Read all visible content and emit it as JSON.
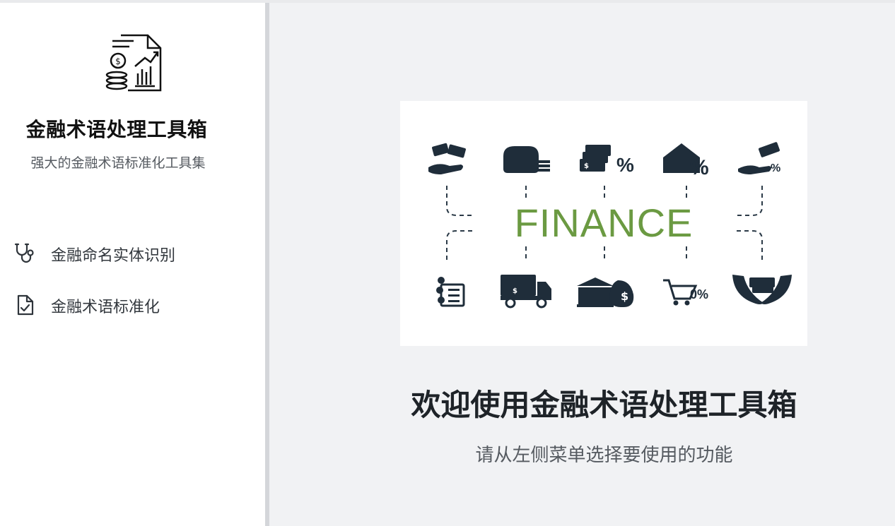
{
  "sidebar": {
    "logo_icon": "finance-report-icon",
    "title": "金融术语处理工具箱",
    "subtitle": "强大的金融术语标准化工具集",
    "items": [
      {
        "label": "金融命名实体识别",
        "icon": "stethoscope-icon"
      },
      {
        "label": "金融术语标准化",
        "icon": "file-check-icon"
      }
    ]
  },
  "main": {
    "hero_text": "FINANCE",
    "welcome_title": "欢迎使用金融术语处理工具箱",
    "hint": "请从左侧菜单选择要使用的功能"
  },
  "colors": {
    "icon_dark": "#1f2d3a",
    "finance_green": "#6b9a42",
    "sidebar_bg": "#ffffff",
    "main_bg": "#f1f2f4"
  }
}
